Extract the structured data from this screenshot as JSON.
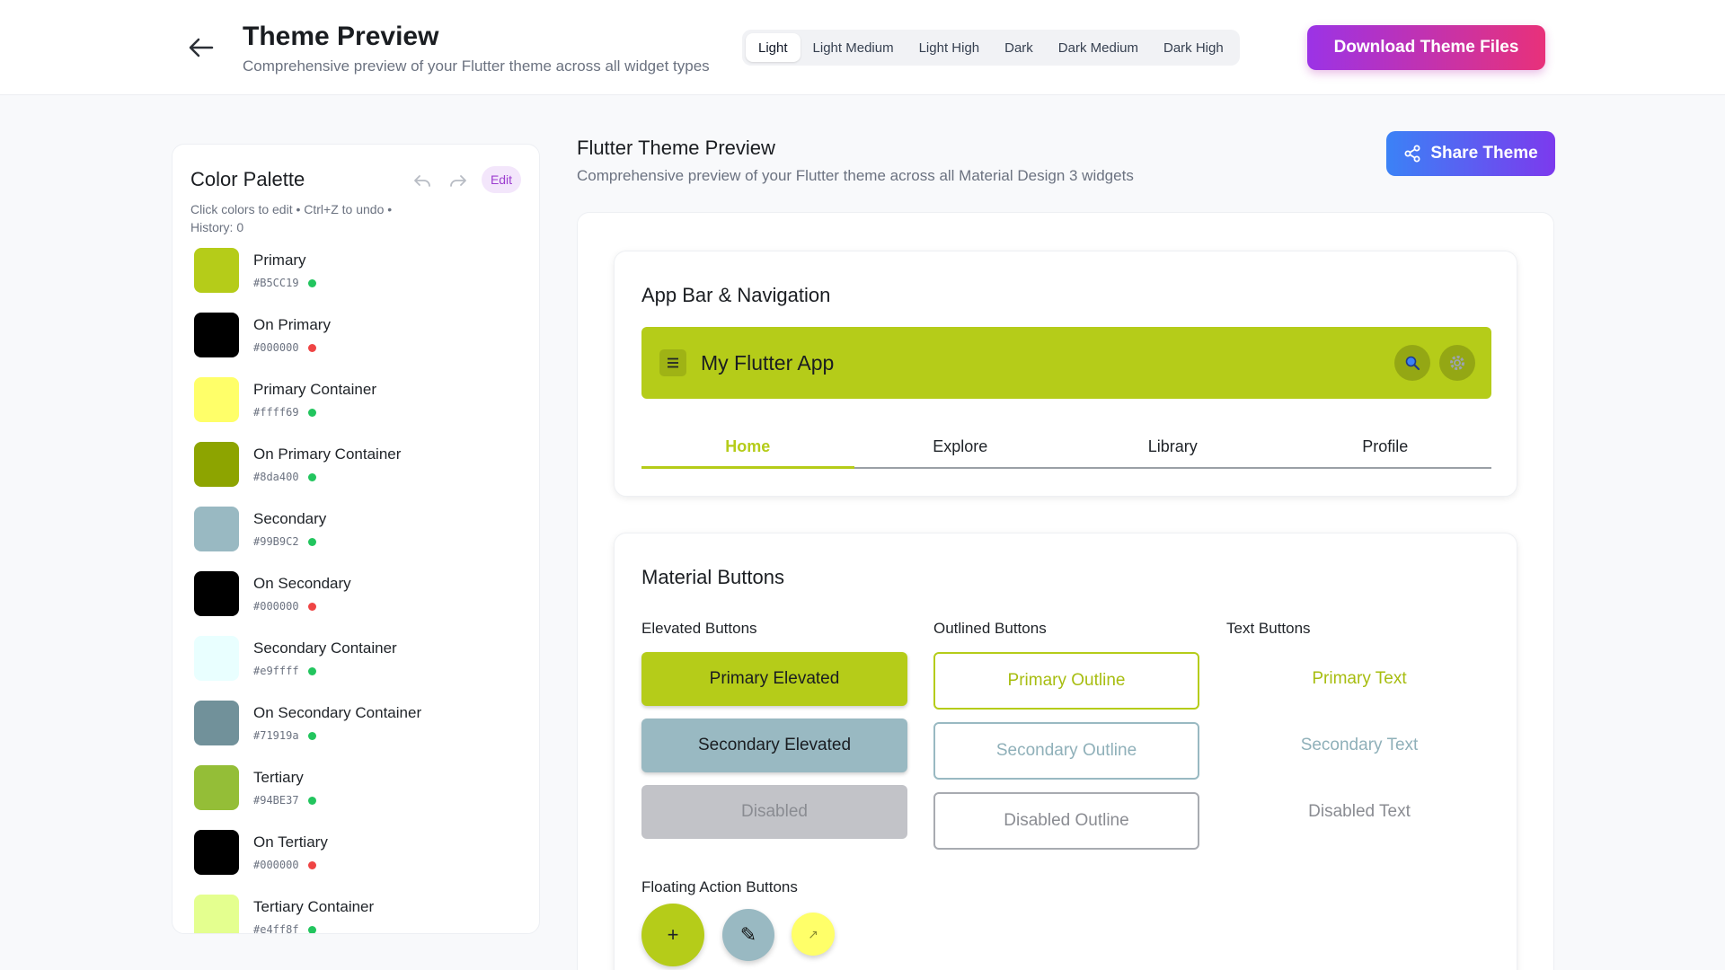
{
  "header": {
    "title": "Theme Preview",
    "subtitle": "Comprehensive preview of your Flutter theme across all widget types",
    "modes": [
      "Light",
      "Light Medium",
      "Light High",
      "Dark",
      "Dark Medium",
      "Dark High"
    ],
    "active_mode": "Light",
    "download_label": "Download Theme Files"
  },
  "palette": {
    "title": "Color Palette",
    "edit_label": "Edit",
    "hint": "Click colors to edit • Ctrl+Z to undo • History: 0",
    "colors": [
      {
        "name": "Primary",
        "hex": "#B5CC19",
        "contrast": "#22c55e"
      },
      {
        "name": "On Primary",
        "hex": "#000000",
        "contrast": "#ef4444"
      },
      {
        "name": "Primary Container",
        "hex": "#ffff69",
        "contrast": "#22c55e"
      },
      {
        "name": "On Primary Container",
        "hex": "#8da400",
        "contrast": "#22c55e"
      },
      {
        "name": "Secondary",
        "hex": "#99B9C2",
        "contrast": "#22c55e"
      },
      {
        "name": "On Secondary",
        "hex": "#000000",
        "contrast": "#ef4444"
      },
      {
        "name": "Secondary Container",
        "hex": "#e9ffff",
        "contrast": "#22c55e"
      },
      {
        "name": "On Secondary Container",
        "hex": "#71919a",
        "contrast": "#22c55e"
      },
      {
        "name": "Tertiary",
        "hex": "#94BE37",
        "contrast": "#22c55e"
      },
      {
        "name": "On Tertiary",
        "hex": "#000000",
        "contrast": "#ef4444"
      },
      {
        "name": "Tertiary Container",
        "hex": "#e4ff8f",
        "contrast": "#22c55e"
      }
    ]
  },
  "main": {
    "title": "Flutter Theme Preview",
    "subtitle": "Comprehensive preview of your Flutter theme across all Material Design 3 widgets",
    "share_label": "Share Theme"
  },
  "appbar_card": {
    "title": "App Bar & Navigation",
    "app_title": "My Flutter App",
    "actions": [
      "search-icon",
      "settings-icon"
    ],
    "tabs": [
      "Home",
      "Explore",
      "Library",
      "Profile"
    ],
    "active_tab": "Home"
  },
  "buttons_card": {
    "title": "Material Buttons",
    "elevated": {
      "label": "Elevated Buttons",
      "primary": "Primary Elevated",
      "secondary": "Secondary Elevated",
      "disabled": "Disabled"
    },
    "outlined": {
      "label": "Outlined Buttons",
      "primary": "Primary Outline",
      "secondary": "Secondary Outline",
      "disabled": "Disabled Outline"
    },
    "text": {
      "label": "Text Buttons",
      "primary": "Primary Text",
      "secondary": "Secondary Text",
      "disabled": "Disabled Text"
    },
    "fab_label": "Floating Action Buttons",
    "fabs": [
      {
        "icon": "plus-icon",
        "glyph": "+"
      },
      {
        "icon": "edit-icon",
        "glyph": "✎"
      },
      {
        "icon": "navigate-icon",
        "glyph": "↗"
      }
    ]
  },
  "colors": {
    "primary": "#B5CC19",
    "secondary": "#99B9C2",
    "primary_container": "#ffff69",
    "disabled_bg": "#c2c3c8",
    "disabled_text": "#8a8c92",
    "disabled_border": "#a8abb1",
    "primary_outline_text": "#a7bd10",
    "secondary_text": "#8fb0b9",
    "brand_purple": "#9b33e6",
    "brand_pink": "#e8317a"
  }
}
